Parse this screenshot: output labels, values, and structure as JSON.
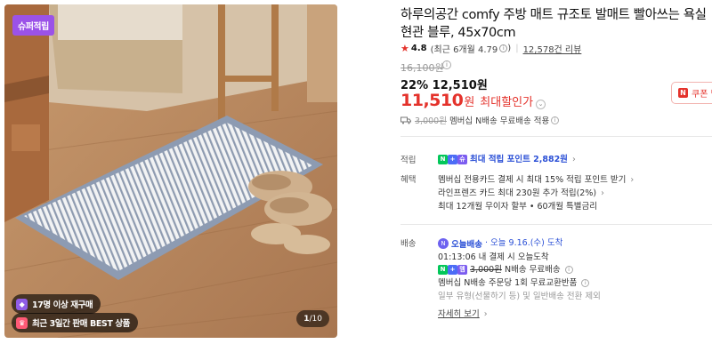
{
  "gallery": {
    "badge": "슈퍼적립",
    "pill_repurchase": "17명 이상 재구매",
    "pill_best": "최근 3일간 판매 BEST 상품",
    "pager_current": "1",
    "pager_total": "/10"
  },
  "product": {
    "title": "하루의공간 comfy 주방 매트 규조토 발매트 빨아쓰는 욕실 현관 블루, 45x70cm",
    "rating_score": "4.8",
    "rating_period": "(최근 6개월 4.79",
    "rating_period_end": ")",
    "review_count": "12,578건 리뷰"
  },
  "price": {
    "original": "16,100원",
    "discount_rate": "22%",
    "discount_price": "12,510원",
    "max_price": "11,510",
    "max_unit": "원",
    "max_label": "최대할인가",
    "coupon_label": "쿠폰 받"
  },
  "shipping_top": {
    "strike": "3,000원",
    "text": "멤버십 N배송 무료배송 적용"
  },
  "benefits": {
    "earn_label": "적립",
    "earn_text": "최대 적립 포인트 2,882원",
    "benefit_label": "혜택",
    "benefit_1": "멤버십 전용카드 결제 시 최대 15% 적립 포인트 받기",
    "benefit_2": "라인프렌즈 카드 최대 230원 추가 적립(2%)",
    "benefit_3": "최대 12개월 무이자 할부 • 60개월 특별금리"
  },
  "delivery": {
    "label": "배송",
    "today_name": "오늘배송",
    "today_date": "· 오늘 9.16.(수) 도착",
    "deadline": "01:13:06  내 결제 시 오늘도착",
    "free_strike": "3,000원",
    "free_text": "N배송 무료배송",
    "exchange": "멤버십 N배송 주문당 1회 무료교환반품",
    "exclude": "일부 유형(선물하기 등) 및 일반배송 전환 제외",
    "more": "자세히 보기"
  },
  "icons": {
    "star": "★",
    "chevron": "›",
    "info": "i"
  },
  "colors": {
    "accent_red": "#e4322b",
    "naver_green": "#03c75a",
    "link_blue": "#2a4fd6",
    "badge_purple": "#9b52e8"
  }
}
